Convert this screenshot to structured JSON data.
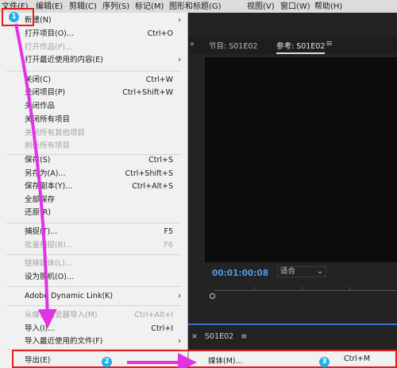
{
  "menubar": {
    "items": [
      "文件(F)",
      "编辑(E)",
      "剪辑(C)",
      "序列(S)",
      "标记(M)",
      "图形和标题(G)",
      "视图(V)",
      "窗口(W)",
      "帮助(H)"
    ]
  },
  "file_menu": {
    "new": {
      "label": "新建(N)",
      "has_submenu": true
    },
    "open_project": {
      "label": "打开项目(O)...",
      "shortcut": "Ctrl+O"
    },
    "open_work": {
      "label": "打开作品(P)..."
    },
    "open_recent": {
      "label": "打开最近使用的内容(E)",
      "has_submenu": true
    },
    "close": {
      "label": "关闭(C)",
      "shortcut": "Ctrl+W"
    },
    "close_project": {
      "label": "关闭项目(P)",
      "shortcut": "Ctrl+Shift+W"
    },
    "close_work": {
      "label": "关闭作品"
    },
    "close_all_projects": {
      "label": "关闭所有项目"
    },
    "close_all_other_projects": {
      "label": "关闭所有其他项目"
    },
    "refresh_all_projects": {
      "label": "刷新所有项目"
    },
    "save": {
      "label": "保存(S)",
      "shortcut": "Ctrl+S"
    },
    "save_as": {
      "label": "另存为(A)...",
      "shortcut": "Ctrl+Shift+S"
    },
    "save_copy": {
      "label": "保存副本(Y)...",
      "shortcut": "Ctrl+Alt+S"
    },
    "save_all": {
      "label": "全部保存"
    },
    "revert": {
      "label": "还原(R)"
    },
    "capture": {
      "label": "捕捉(T)...",
      "shortcut": "F5"
    },
    "batch_capture": {
      "label": "批量捕捉(B)...",
      "shortcut": "F6"
    },
    "link_media": {
      "label": "链接媒体(L)..."
    },
    "make_offline": {
      "label": "设为脱机(O)..."
    },
    "dynamic_link": {
      "label": "Adobe Dynamic Link(K)",
      "has_submenu": true
    },
    "import_from_browser": {
      "label": "从媒体浏览器导入(M)",
      "shortcut": "Ctrl+Alt+I"
    },
    "import": {
      "label": "导入(I)...",
      "shortcut": "Ctrl+I"
    },
    "import_recent": {
      "label": "导入最近使用的文件(F)",
      "has_submenu": true
    },
    "export": {
      "label": "导出(E)",
      "has_submenu": true
    }
  },
  "export_submenu": {
    "media": {
      "label": "媒体(M)...",
      "shortcut": "Ctrl+M"
    }
  },
  "panel": {
    "chevron": "»",
    "tab_program": "节目: S01E02",
    "tab_reference": "参考: S01E02",
    "tab_menu_icon": "≡",
    "timecode": "00:01:00:08",
    "fit_select": "适合",
    "bottom_tab_close": "×",
    "bottom_tab": "S01E02",
    "bottom_tab_menu_icon": "≡"
  },
  "annotations": {
    "badges": [
      "1",
      "2",
      "3"
    ],
    "badge_color": "#1fb0e8",
    "highlight_color": "#e02020",
    "arrow_color": "#e033e6"
  }
}
